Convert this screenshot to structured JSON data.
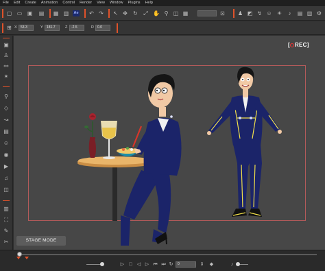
{
  "menu": [
    "File",
    "Edit",
    "Create",
    "Animation",
    "Control",
    "Render",
    "View",
    "Window",
    "Plugins",
    "Help"
  ],
  "toolbar": {
    "ae_label": "Ae",
    "coords": [
      {
        "label": "X",
        "value": "53.3"
      },
      {
        "label": "Y",
        "value": "181.7"
      },
      {
        "label": "Z",
        "value": "-2.5"
      },
      {
        "label": "R",
        "value": "0.0"
      }
    ]
  },
  "viewport": {
    "rec_label": "REC",
    "stage_mode_label": "STAGE MODE"
  },
  "timeline": {
    "frame_value": "0"
  },
  "colors": {
    "accent": "#e0522a",
    "background": "#474747",
    "suit": "#1b2469",
    "table": "#e3a85b",
    "rec_dot": "#e33333"
  }
}
